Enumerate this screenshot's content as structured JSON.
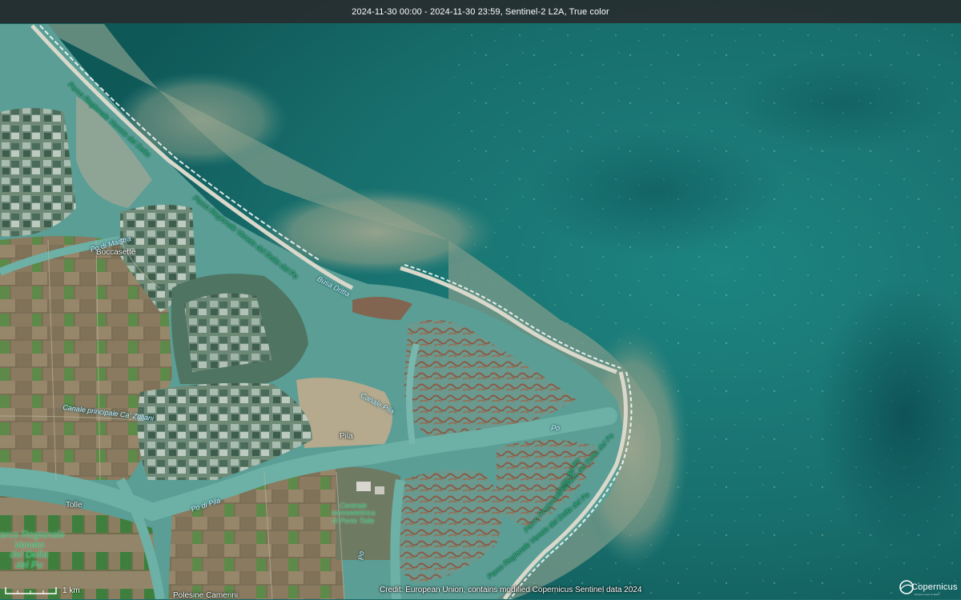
{
  "header": {
    "title": "2024-11-30 00:00 - 2024-11-30 23:59, Sentinel-2 L2A, True color"
  },
  "map": {
    "place_labels": {
      "boccasette": "Boccasette",
      "pila": "Pila",
      "tolle": "Tolle",
      "polesine_camerini": "Polesine Camerini"
    },
    "water_labels": {
      "po_di_maistra": "Po di Maistra",
      "canale_principale": "Canale principale Ca' Zuliani",
      "canale_pila": "Canale Pila",
      "po": "Po",
      "po_di_pila": "Po di Pila",
      "busa_dritta": "Busa Dritta",
      "po_short": "Po"
    },
    "park_labels": {
      "corner_park": "Parco Regionale\nVeneto\ndel Delta\ndel Po",
      "coast_park_1": "Parco Regionale Veneto del Delta",
      "coast_park_2": "Parco Regionale Veneto del Delta del Po",
      "coast_park_3": "Parco Regionale Veneto del Delta del Po",
      "coast_park_4": "Parco Regionale Veneto del Delta del Po",
      "coast_park_5": "Delta del Po"
    },
    "poi_labels": {
      "centrale": "Centrale termoelettrica di Porto Tolle"
    },
    "scale_label": "1 km",
    "credit": "Credit: European Union, contains modified Copernicus Sentinel data 2024",
    "logo": "Copernicus",
    "logo_sub": "Europe's eyes on Earth"
  },
  "colors": {
    "sea_deep": "#14605f",
    "sea_mid": "#1b7a76",
    "turbid_water": "#8c9a86",
    "lagoon": "#5ea49a",
    "farmland": "#8b7d62",
    "green_field": "#4f8a44",
    "wetland": "#6e7a5a",
    "beach": "#e6e3d6",
    "park_text": "#27b46a"
  }
}
